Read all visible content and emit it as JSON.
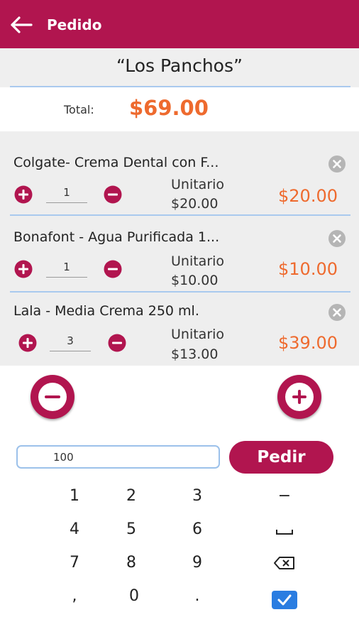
{
  "header": {
    "title": "Pedido",
    "background_color": "#b1154f",
    "back_icon": "arrow-left-icon"
  },
  "store": {
    "name": "“Los Panchos”"
  },
  "summary": {
    "total_label": "Total:",
    "total_value": "$69.00"
  },
  "items": [
    {
      "name": "Colgate- Crema Dental con F...",
      "quantity": "1",
      "unit_label": "Unitario",
      "unit_price": "$20.00",
      "subtotal": "$20.00"
    },
    {
      "name": "Bonafont - Agua Purificada 1...",
      "quantity": "1",
      "unit_label": "Unitario",
      "unit_price": "$10.00",
      "subtotal": "$10.00"
    },
    {
      "name": "Lala - Media Crema 250 ml.",
      "quantity": "3",
      "unit_label": "Unitario",
      "unit_price": "$13.00",
      "subtotal": "$39.00"
    }
  ],
  "order_form": {
    "quantity_value": "100",
    "order_button_label": "Pedir"
  },
  "keypad": {
    "rows": [
      [
        "1",
        "2",
        "3",
        "−"
      ],
      [
        "4",
        "5",
        "6",
        "space-icon"
      ],
      [
        "7",
        "8",
        "9",
        "backspace-icon"
      ],
      [
        ",",
        "0",
        ".",
        "done-check-icon"
      ]
    ]
  },
  "colors": {
    "brand": "#b1154f",
    "price": "#ee6a2e",
    "divider": "#a9c9ee"
  }
}
